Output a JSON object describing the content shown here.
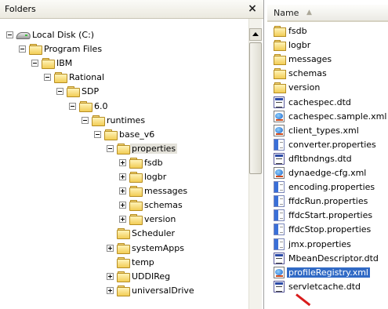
{
  "folders_pane": {
    "title": "Folders",
    "close_glyph": "×"
  },
  "tree": [
    {
      "label": "Local Disk (C:)",
      "icon": "drive-icon",
      "expander": "minus",
      "depth": 0,
      "selected": false
    },
    {
      "label": "Program Files",
      "icon": "folder-open-icon",
      "expander": "minus",
      "depth": 1,
      "selected": false
    },
    {
      "label": "IBM",
      "icon": "folder-open-icon",
      "expander": "minus",
      "depth": 2,
      "selected": false
    },
    {
      "label": "Rational",
      "icon": "folder-open-icon",
      "expander": "minus",
      "depth": 3,
      "selected": false
    },
    {
      "label": "SDP",
      "icon": "folder-open-icon",
      "expander": "minus",
      "depth": 4,
      "selected": false
    },
    {
      "label": "6.0",
      "icon": "folder-open-icon",
      "expander": "minus",
      "depth": 5,
      "selected": false
    },
    {
      "label": "runtimes",
      "icon": "folder-open-icon",
      "expander": "minus",
      "depth": 6,
      "selected": false
    },
    {
      "label": "base_v6",
      "icon": "folder-open-icon",
      "expander": "minus",
      "depth": 7,
      "selected": false
    },
    {
      "label": "properties",
      "icon": "folder-open-icon",
      "expander": "minus",
      "depth": 8,
      "selected": true
    },
    {
      "label": "fsdb",
      "icon": "folder-icon",
      "expander": "plus",
      "depth": 9,
      "selected": false
    },
    {
      "label": "logbr",
      "icon": "folder-icon",
      "expander": "plus",
      "depth": 9,
      "selected": false
    },
    {
      "label": "messages",
      "icon": "folder-icon",
      "expander": "plus",
      "depth": 9,
      "selected": false
    },
    {
      "label": "schemas",
      "icon": "folder-icon",
      "expander": "plus",
      "depth": 9,
      "selected": false
    },
    {
      "label": "version",
      "icon": "folder-icon",
      "expander": "plus",
      "depth": 9,
      "selected": false
    },
    {
      "label": "Scheduler",
      "icon": "folder-icon",
      "expander": "none",
      "depth": 8,
      "selected": false
    },
    {
      "label": "systemApps",
      "icon": "folder-icon",
      "expander": "plus",
      "depth": 8,
      "selected": false
    },
    {
      "label": "temp",
      "icon": "folder-icon",
      "expander": "none",
      "depth": 8,
      "selected": false
    },
    {
      "label": "UDDIReg",
      "icon": "folder-icon",
      "expander": "plus",
      "depth": 8,
      "selected": false
    },
    {
      "label": "universalDrive",
      "icon": "folder-icon",
      "expander": "plus",
      "depth": 8,
      "selected": false
    }
  ],
  "files_pane": {
    "column_name": "Name",
    "sort_glyph": "▲"
  },
  "files": [
    {
      "label": "fsdb",
      "icon": "folder-icon",
      "selected": false
    },
    {
      "label": "logbr",
      "icon": "folder-icon",
      "selected": false
    },
    {
      "label": "messages",
      "icon": "folder-icon",
      "selected": false
    },
    {
      "label": "schemas",
      "icon": "folder-icon",
      "selected": false
    },
    {
      "label": "version",
      "icon": "folder-icon",
      "selected": false
    },
    {
      "label": "cachespec.dtd",
      "icon": "dtd-file-icon",
      "selected": false
    },
    {
      "label": "cachespec.sample.xml",
      "icon": "xml-file-icon",
      "selected": false
    },
    {
      "label": "client_types.xml",
      "icon": "xml-file-icon",
      "selected": false
    },
    {
      "label": "converter.properties",
      "icon": "properties-file-icon",
      "selected": false
    },
    {
      "label": "dfltbndngs.dtd",
      "icon": "dtd-file-icon",
      "selected": false
    },
    {
      "label": "dynaedge-cfg.xml",
      "icon": "xml-file-icon",
      "selected": false
    },
    {
      "label": "encoding.properties",
      "icon": "properties-file-icon",
      "selected": false
    },
    {
      "label": "ffdcRun.properties",
      "icon": "properties-file-icon",
      "selected": false
    },
    {
      "label": "ffdcStart.properties",
      "icon": "properties-file-icon",
      "selected": false
    },
    {
      "label": "ffdcStop.properties",
      "icon": "properties-file-icon",
      "selected": false
    },
    {
      "label": "jmx.properties",
      "icon": "properties-file-icon",
      "selected": false
    },
    {
      "label": "MbeanDescriptor.dtd",
      "icon": "dtd-file-icon",
      "selected": false
    },
    {
      "label": "profileRegistry.xml",
      "icon": "xml-file-icon",
      "selected": true
    },
    {
      "label": "servletcache.dtd",
      "icon": "dtd-file-icon",
      "selected": false
    }
  ],
  "colors": {
    "selection": "#316ac5",
    "tree_selection": "#e4e2da"
  }
}
